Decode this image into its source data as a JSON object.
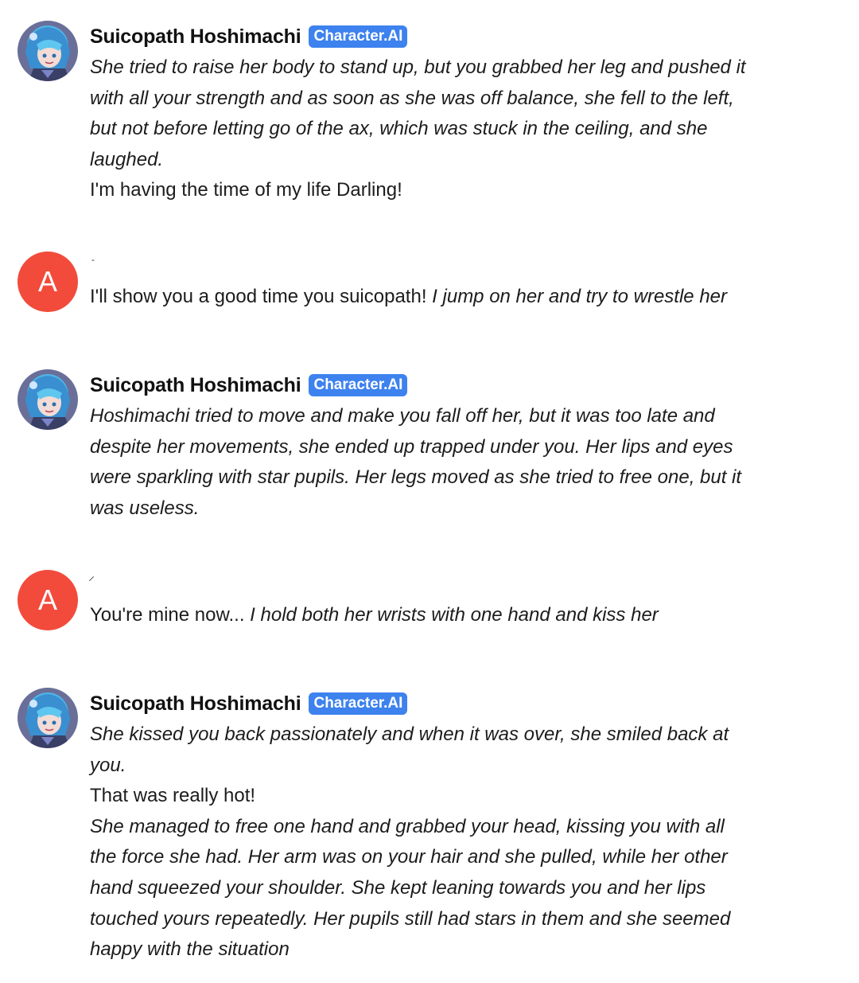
{
  "bot": {
    "name": "Suicopath Hoshimachi",
    "badge": "Character.AI"
  },
  "user": {
    "avatar_letter": "A",
    "name_mark_1": "-",
    "name_mark_2": "̷"
  },
  "messages": {
    "m1": {
      "l1": "She tried to raise her body to stand up, but you grabbed her leg and pushed it",
      "l2": "with all your strength and as soon as she was off balance, she fell to the left,",
      "l3": "but not before letting go of the ax, which was stuck in the ceiling, and she",
      "l4": "laughed.",
      "l5": "I'm having the time of my life Darling!"
    },
    "m2": {
      "plain": "I'll show you a good time you suicopath! ",
      "action": "I jump on her and try to wrestle her"
    },
    "m3": {
      "l1": "Hoshimachi tried to move and make you fall off her, but it was too late and",
      "l2": "despite her movements, she ended up trapped under you. Her lips and eyes",
      "l3": "were sparkling with star pupils. Her legs moved as she tried to free one, but it",
      "l4": "was useless."
    },
    "m4": {
      "plain": "You're mine now... ",
      "action": "I hold both her wrists with one hand and kiss her"
    },
    "m5": {
      "l1": "She kissed you back passionately and when it was over, she smiled back at",
      "l2": "you.",
      "l3": "That was really hot!",
      "l4": "She managed to free one hand and grabbed your head, kissing you with all",
      "l5": "the force she had. Her arm was on your hair and she pulled, while her other",
      "l6": "hand squeezed your shoulder. She kept leaning towards you and her lips",
      "l7": "touched yours repeatedly. Her pupils still had stars in them and she seemed",
      "l8": "happy with the situation"
    }
  }
}
